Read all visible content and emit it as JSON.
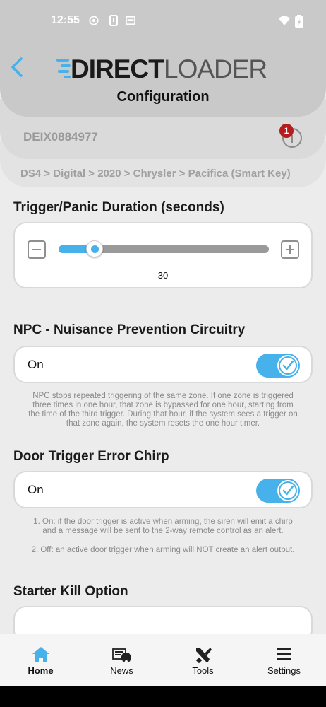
{
  "status_bar": {
    "time": "12:55"
  },
  "header": {
    "logo_text": "DIRECTLOADER",
    "title": "Configuration"
  },
  "device": {
    "id": "DEIX0884977",
    "notification_count": "1"
  },
  "breadcrumb": "DS4 > Digital > 2020 > Chrysler > Pacifica (Smart Key)",
  "trigger": {
    "title": "Trigger/Panic Duration (seconds)",
    "value": "30",
    "level": 0.17
  },
  "npc": {
    "title": "NPC - Nuisance Prevention Circuitry",
    "toggle_label": "On",
    "note": "NPC stops repeated triggering of the same zone. If one zone is triggered three times in one hour, that zone is bypassed for one hour, starting from the time of the third trigger. During that hour, if the system sees a trigger on that zone again, the system resets the one hour timer."
  },
  "door_chirp": {
    "title": "Door Trigger Error Chirp",
    "toggle_label": "On",
    "note_1": "1. On: if the door trigger is active when arming, the siren will emit a chirp and a message will be sent to the 2-way remote control as an alert.",
    "note_2": "2. Off: an active door trigger when arming will NOT create an alert output."
  },
  "starter_kill": {
    "title": "Starter Kill Option"
  },
  "nav": [
    {
      "label": "Home",
      "icon": "home-icon"
    },
    {
      "label": "News",
      "icon": "news-icon"
    },
    {
      "label": "Tools",
      "icon": "tools-icon"
    },
    {
      "label": "Settings",
      "icon": "menu-icon"
    }
  ],
  "colors": {
    "accent": "#46b1ea",
    "badge": "#b71c1c",
    "header_bg": "#c9c9c9"
  }
}
